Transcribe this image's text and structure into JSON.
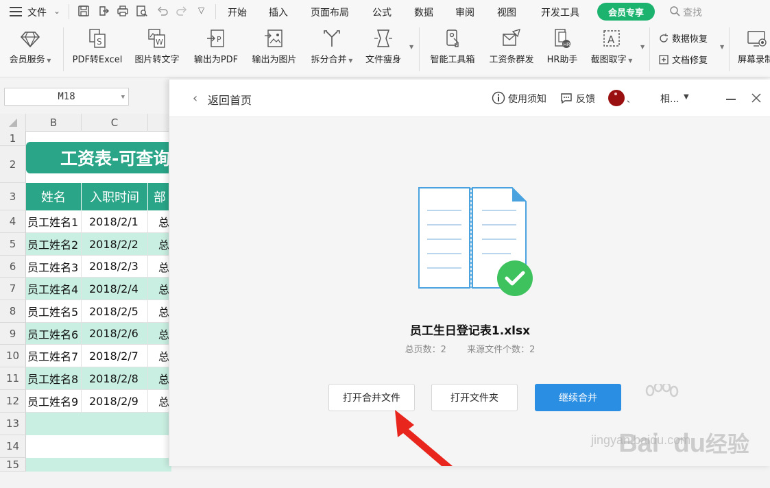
{
  "menubar": {
    "file": "文件",
    "tabs": [
      "开始",
      "插入",
      "页面布局",
      "公式",
      "数据",
      "审阅",
      "视图",
      "开发工具"
    ],
    "vip_tab": "会员专享",
    "search": "查找"
  },
  "ribbon": {
    "member_service": "会员服务",
    "pdf_to_excel": "PDF转Excel",
    "image_to_text": "图片转文字",
    "export_pdf": "输出为PDF",
    "export_image": "输出为图片",
    "split_merge": "拆分合并",
    "file_slim": "文件瘦身",
    "smart_toolbox": "智能工具箱",
    "salary_mail": "工资条群发",
    "hr_helper": "HR助手",
    "screenshot_ocr": "截图取字",
    "data_recovery": "数据恢复",
    "doc_repair": "文档修复",
    "screen_record": "屏幕录制"
  },
  "namebox": {
    "value": "M18"
  },
  "sheet": {
    "col_headers": [
      "B",
      "C"
    ],
    "row_numbers": [
      "1",
      "2",
      "3",
      "4",
      "5",
      "6",
      "7",
      "8",
      "9",
      "10",
      "11",
      "12",
      "13",
      "14",
      "15"
    ],
    "title": "工资表-可查询",
    "headers": [
      "姓名",
      "入职时间",
      "部"
    ],
    "rows": [
      {
        "name": "员工姓名1",
        "date": "2018/2/1",
        "dept": "总"
      },
      {
        "name": "员工姓名2",
        "date": "2018/2/2",
        "dept": "总"
      },
      {
        "name": "员工姓名3",
        "date": "2018/2/3",
        "dept": "总"
      },
      {
        "name": "员工姓名4",
        "date": "2018/2/4",
        "dept": "总"
      },
      {
        "name": "员工姓名5",
        "date": "2018/2/5",
        "dept": "总"
      },
      {
        "name": "员工姓名6",
        "date": "2018/2/6",
        "dept": "总"
      },
      {
        "name": "员工姓名7",
        "date": "2018/2/7",
        "dept": "总"
      },
      {
        "name": "员工姓名8",
        "date": "2018/2/8",
        "dept": "总"
      },
      {
        "name": "员工姓名9",
        "date": "2018/2/9",
        "dept": "总"
      }
    ]
  },
  "dialog": {
    "back": "返回首页",
    "usage_notes": "使用须知",
    "feedback": "反馈",
    "user_name": "相...",
    "file_name": "员工生日登记表1.xlsx",
    "total_pages_label": "总页数：2",
    "source_count_label": "来源文件个数：2",
    "open_merged": "打开合并文件",
    "open_folder": "打开文件夹",
    "continue_merge": "继续合并"
  },
  "watermark": {
    "brand": "Bai  du",
    "brand_cn": "经验",
    "url": "jingyan.baidu.com"
  },
  "colors": {
    "accent_green": "#1cb36f",
    "table_teal": "#2aa587",
    "row_tint": "#c9efe2",
    "primary_blue": "#2a8ee3",
    "check_green": "#3ec25e",
    "arrow_red": "#e8261d"
  }
}
